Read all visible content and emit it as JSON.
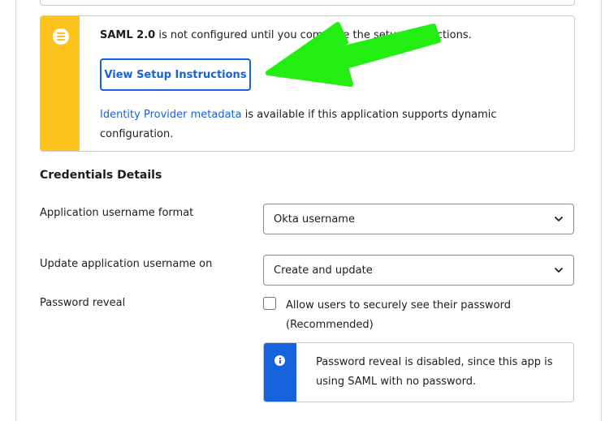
{
  "notice": {
    "title_bold": "SAML 2.0",
    "title_rest": " is not configured until you complete the setup instructions.",
    "button_label": "View Setup Instructions",
    "metadata_link": "Identity Provider metadata",
    "metadata_rest": " is available if this application supports dynamic configuration.",
    "icon": "list-icon",
    "accent_color": "#fbc31c"
  },
  "credentials": {
    "section_title": "Credentials Details",
    "username_format": {
      "label": "Application username format",
      "value": "Okta username"
    },
    "update_on": {
      "label": "Update application username on",
      "value": "Create and update"
    },
    "password_reveal": {
      "label": "Password reveal",
      "checkbox_label": "Allow users to securely see their password (Recommended)",
      "checked": false
    },
    "info": {
      "text": "Password reveal is disabled, since this app is using SAML with no password.",
      "icon": "info-icon",
      "accent_color": "#1662dd"
    }
  },
  "annotation": {
    "arrow_color": "#22ee11"
  }
}
